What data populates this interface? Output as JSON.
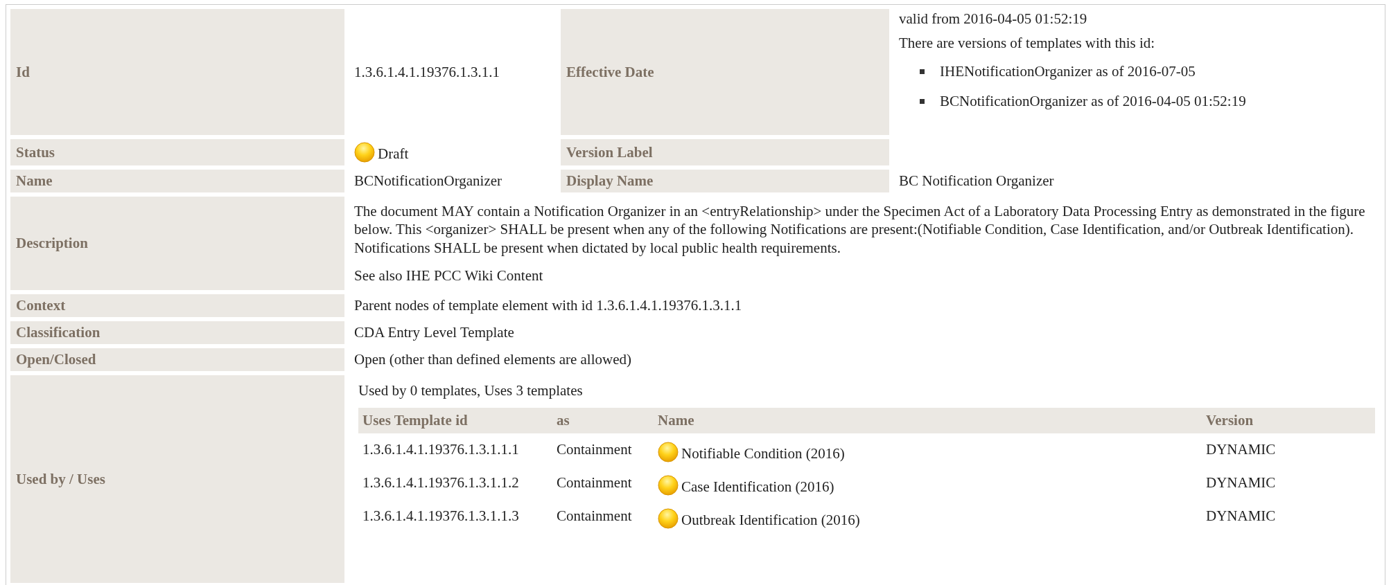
{
  "id": {
    "label": "Id",
    "value": "1.3.6.1.4.1.19376.1.3.1.1"
  },
  "effective_date": {
    "label": "Effective Date",
    "valid_from": "valid from 2016-04-05 01:52:19",
    "versions_heading": "There are versions of templates with this id:",
    "versions": [
      "IHENotificationOrganizer as of 2016-07-05",
      "BCNotificationOrganizer as of 2016-04-05 01:52:19"
    ]
  },
  "status": {
    "label": "Status",
    "value": "Draft"
  },
  "version_label": {
    "label": "Version Label"
  },
  "name": {
    "label": "Name",
    "value": "BCNotificationOrganizer"
  },
  "display_name": {
    "label": "Display Name",
    "value": "BC Notification Organizer"
  },
  "description": {
    "label": "Description",
    "text": "The document MAY contain a Notification Organizer in an <entryRelationship> under the Specimen Act of a Laboratory Data Processing Entry as demonstrated in the figure below. This <organizer> SHALL be present when any of the following Notifications are present:(Notifiable Condition, Case Identification, and/or Outbreak Identification). Notifications SHALL be present when dictated by local public health requirements.",
    "see_also": "See also IHE PCC Wiki Content"
  },
  "context": {
    "label": "Context",
    "value": "Parent nodes of template element with id 1.3.6.1.4.1.19376.1.3.1.1"
  },
  "classification": {
    "label": "Classification",
    "value": "CDA Entry Level Template"
  },
  "open_closed": {
    "label": "Open/Closed",
    "value": "Open (other than defined elements are allowed)"
  },
  "used_by": {
    "label": "Used by / Uses",
    "summary": "Used by 0 templates, Uses 3 templates",
    "columns": [
      "Uses Template id",
      "as",
      "Name",
      "Version"
    ],
    "rows": [
      {
        "template_id": "1.3.6.1.4.1.19376.1.3.1.1.1",
        "as": "Containment",
        "name": "Notifiable Condition (2016)",
        "version": "DYNAMIC"
      },
      {
        "template_id": "1.3.6.1.4.1.19376.1.3.1.1.2",
        "as": "Containment",
        "name": "Case Identification (2016)",
        "version": "DYNAMIC"
      },
      {
        "template_id": "1.3.6.1.4.1.19376.1.3.1.1.3",
        "as": "Containment",
        "name": "Outbreak Identification (2016)",
        "version": "DYNAMIC"
      }
    ]
  }
}
